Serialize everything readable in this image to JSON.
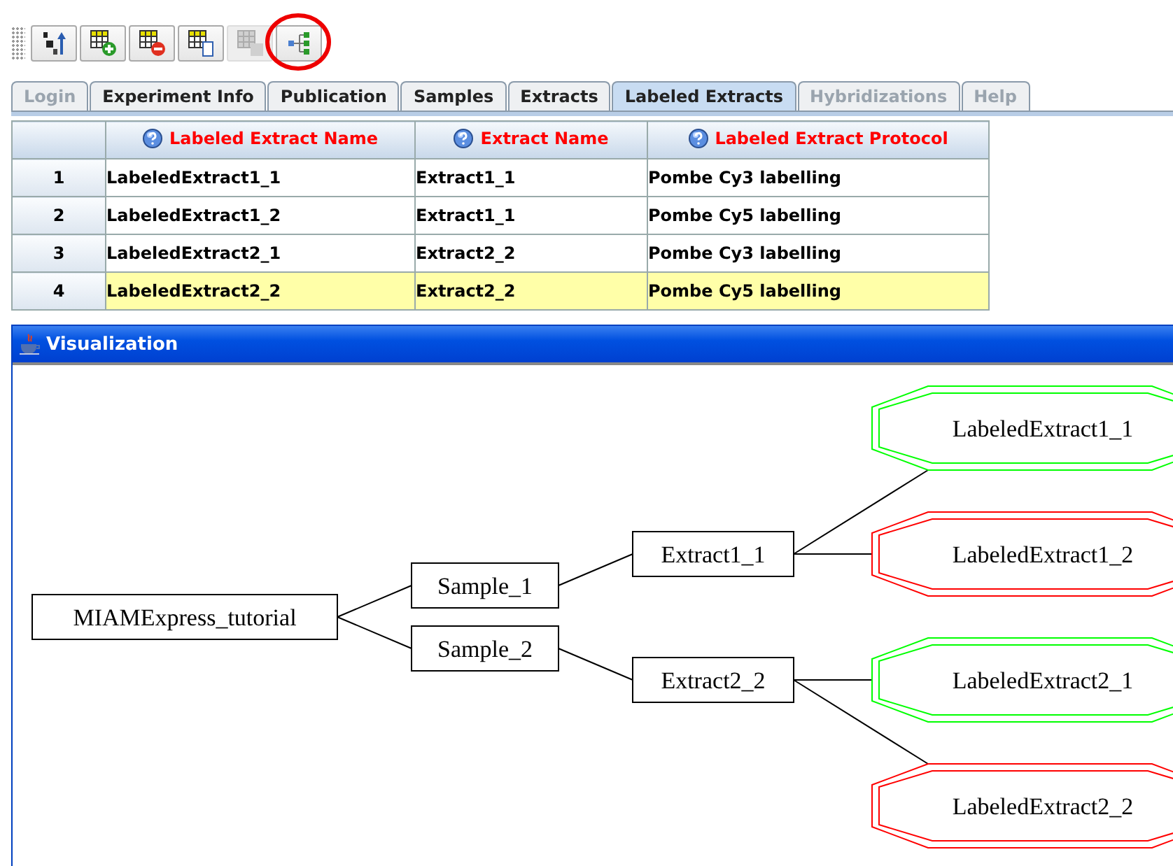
{
  "toolbar": [
    {
      "kind": "sort",
      "disabled": false,
      "circled": false
    },
    {
      "kind": "add-row",
      "disabled": false,
      "circled": false
    },
    {
      "kind": "remove-row",
      "disabled": false,
      "circled": false
    },
    {
      "kind": "copy-row",
      "disabled": false,
      "circled": false
    },
    {
      "kind": "paste-row",
      "disabled": true,
      "circled": false
    },
    {
      "kind": "tree",
      "disabled": false,
      "circled": true
    }
  ],
  "tabs": [
    {
      "label": "Login",
      "selected": false,
      "disabled": true
    },
    {
      "label": "Experiment Info",
      "selected": false,
      "disabled": false
    },
    {
      "label": "Publication",
      "selected": false,
      "disabled": false
    },
    {
      "label": "Samples",
      "selected": false,
      "disabled": false
    },
    {
      "label": "Extracts",
      "selected": false,
      "disabled": false
    },
    {
      "label": "Labeled Extracts",
      "selected": true,
      "disabled": false
    },
    {
      "label": "Hybridizations",
      "selected": false,
      "disabled": true
    },
    {
      "label": "Help",
      "selected": false,
      "disabled": true
    }
  ],
  "table": {
    "columns": [
      "Labeled Extract Name",
      "Extract Name",
      "Labeled Extract Protocol"
    ],
    "rows": [
      {
        "number": "1",
        "cells": [
          "LabeledExtract1_1",
          "Extract1_1",
          "Pombe Cy3 labelling"
        ],
        "selected": false
      },
      {
        "number": "2",
        "cells": [
          "LabeledExtract1_2",
          "Extract1_1",
          "Pombe Cy5 labelling"
        ],
        "selected": false
      },
      {
        "number": "3",
        "cells": [
          "LabeledExtract2_1",
          "Extract2_2",
          "Pombe Cy3 labelling"
        ],
        "selected": false
      },
      {
        "number": "4",
        "cells": [
          "LabeledExtract2_2",
          "Extract2_2",
          "Pombe Cy5 labelling"
        ],
        "selected": true
      }
    ]
  },
  "visualization": {
    "title": "Visualization",
    "graph": {
      "label": "MIAMExpress_tutorial",
      "kind": "box",
      "children": [
        {
          "label": "Sample_1",
          "kind": "box",
          "children": [
            {
              "label": "Extract1_1",
              "kind": "box",
              "children": [
                {
                  "label": "LabeledExtract1_1",
                  "kind": "octagon",
                  "color": "#00ff00"
                },
                {
                  "label": "LabeledExtract1_2",
                  "kind": "octagon",
                  "color": "#ff0000"
                }
              ]
            }
          ]
        },
        {
          "label": "Sample_2",
          "kind": "box",
          "children": [
            {
              "label": "Extract2_2",
              "kind": "box",
              "children": [
                {
                  "label": "LabeledExtract2_1",
                  "kind": "octagon",
                  "color": "#00ff00"
                },
                {
                  "label": "LabeledExtract2_2",
                  "kind": "octagon",
                  "color": "#ff0000"
                }
              ]
            }
          ]
        }
      ]
    }
  }
}
